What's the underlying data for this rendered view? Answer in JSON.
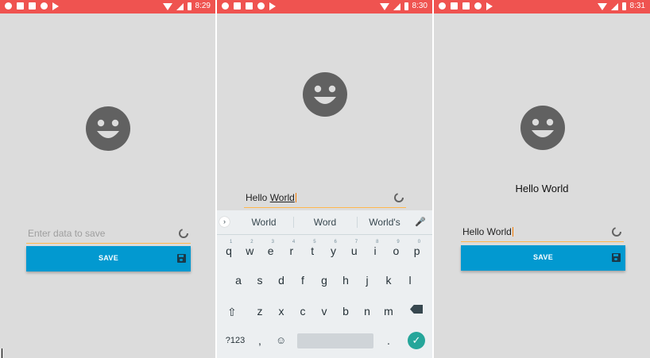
{
  "colors": {
    "statusbar": "#ef5350",
    "background": "#dcdcdc",
    "button": "#0299d0",
    "underline": "#ffb74d",
    "keyboard": "#eceff1",
    "enter": "#26a69a"
  },
  "screens": [
    {
      "time": "8:29",
      "input": {
        "placeholder": "Enter data to save",
        "value": ""
      },
      "button": {
        "label": "SAVE"
      },
      "icons": [
        "smiley-face-icon",
        "refresh-icon",
        "save-icon"
      ]
    },
    {
      "time": "8:30",
      "input": {
        "value_prefix": "Hello ",
        "value_underlined": "World"
      },
      "keyboard": {
        "suggestions": [
          "World",
          "Word",
          "World's"
        ],
        "row1": [
          "q",
          "w",
          "e",
          "r",
          "t",
          "y",
          "u",
          "i",
          "o",
          "p"
        ],
        "row1_hints": [
          "1",
          "2",
          "3",
          "4",
          "5",
          "6",
          "7",
          "8",
          "9",
          "0"
        ],
        "row2": [
          "a",
          "s",
          "d",
          "f",
          "g",
          "h",
          "j",
          "k",
          "l"
        ],
        "row3": [
          "z",
          "x",
          "c",
          "v",
          "b",
          "n",
          "m"
        ],
        "symbols_key": "?123",
        "comma_key": ",",
        "period_key": "."
      }
    },
    {
      "time": "8:31",
      "display_text": "Hello World",
      "input": {
        "value": "Hello World"
      },
      "button": {
        "label": "SAVE"
      }
    }
  ]
}
